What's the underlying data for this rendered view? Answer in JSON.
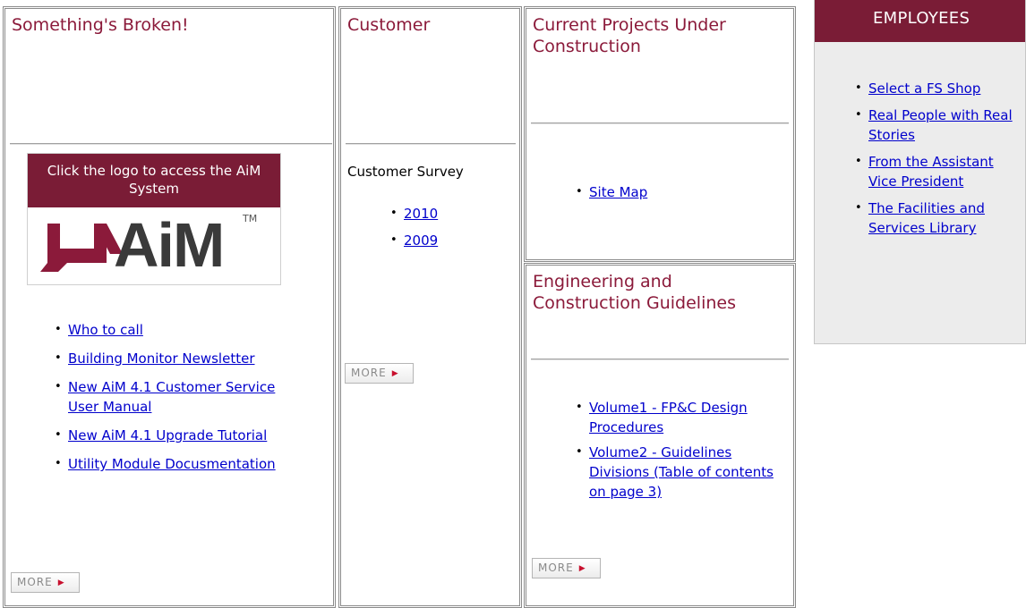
{
  "broken": {
    "title": "Something's Broken!",
    "logo_caption": "Click the logo to access the AiM System",
    "logo_text": "AiM",
    "logo_tm": "TM",
    "links": [
      {
        "label": "Who to call"
      },
      {
        "label": "Building Monitor Newsletter"
      },
      {
        "label": "New AiM 4.1 Customer Service User Manual"
      },
      {
        "label": "New AiM 4.1 Upgrade Tutorial"
      },
      {
        "label": "Utility Module Docusmentation"
      }
    ],
    "more_label": "MORE"
  },
  "customer": {
    "title": "Customer",
    "survey_label": "Customer Survey",
    "links": [
      {
        "label": "2010"
      },
      {
        "label": "2009"
      }
    ],
    "more_label": "MORE"
  },
  "projects": {
    "title": "Current Projects Under Construction",
    "links": [
      {
        "label": "Site Map"
      }
    ]
  },
  "engineering": {
    "title": "Engineering and Construction Guidelines",
    "links": [
      {
        "label": "Volume1 - FP&C Design Procedures"
      },
      {
        "label": "Volume2 - Guidelines Divisions (Table of contents on page 3)"
      }
    ],
    "more_label": "MORE"
  },
  "employees": {
    "title": "EMPLOYEES",
    "links": [
      {
        "label": "Select a FS Shop"
      },
      {
        "label": "Real People with Real Stories"
      },
      {
        "label": "From the Assistant Vice President"
      },
      {
        "label": "The Facilities and Services Library"
      }
    ]
  },
  "colors": {
    "brand_maroon": "#7a1c36",
    "title_maroon": "#8b1a3a",
    "link_blue": "#0000cc",
    "more_arrow_red": "#c8102e"
  }
}
